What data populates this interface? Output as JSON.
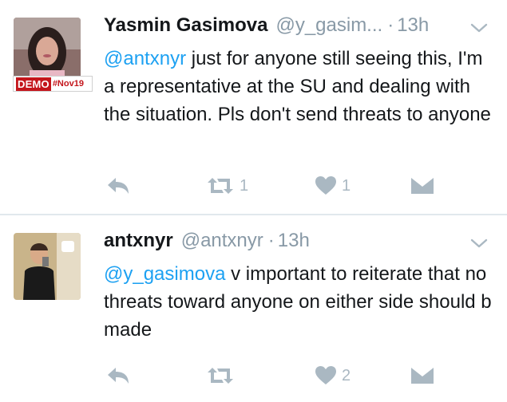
{
  "colors": {
    "name": "#14171a",
    "meta": "#8899a6",
    "mention": "#1da1f2",
    "action_icon": "#aab8c2",
    "divider": "#e1e8ed",
    "badge_red": "#c4161c"
  },
  "tweets": [
    {
      "name": "Yasmin Gasimova",
      "handle": "@y_gasim...",
      "dot": "·",
      "time": "13h",
      "badge": {
        "primary": "DEMO",
        "secondary": "#Nov19"
      },
      "mention": "@antxnyr",
      "text": " just for anyone still seeing this, I'm a representative at the SU and dealing with the situation. Pls don't send threats to anyone",
      "actions": {
        "reply_icon": "reply-icon",
        "retweet_icon": "retweet-icon",
        "retweet_count": "1",
        "like_icon": "heart-icon",
        "like_count": "1",
        "dm_icon": "envelope-icon"
      }
    },
    {
      "name": "antxnyr",
      "handle": "@antxnyr",
      "dot": "·",
      "time": "13h",
      "mention": "@y_gasimova",
      "text": " v important to reiterate that no threats toward anyone on either side should b made",
      "actions": {
        "reply_icon": "reply-icon",
        "retweet_icon": "retweet-icon",
        "retweet_count": "",
        "like_icon": "heart-icon",
        "like_count": "2",
        "dm_icon": "envelope-icon"
      }
    }
  ]
}
